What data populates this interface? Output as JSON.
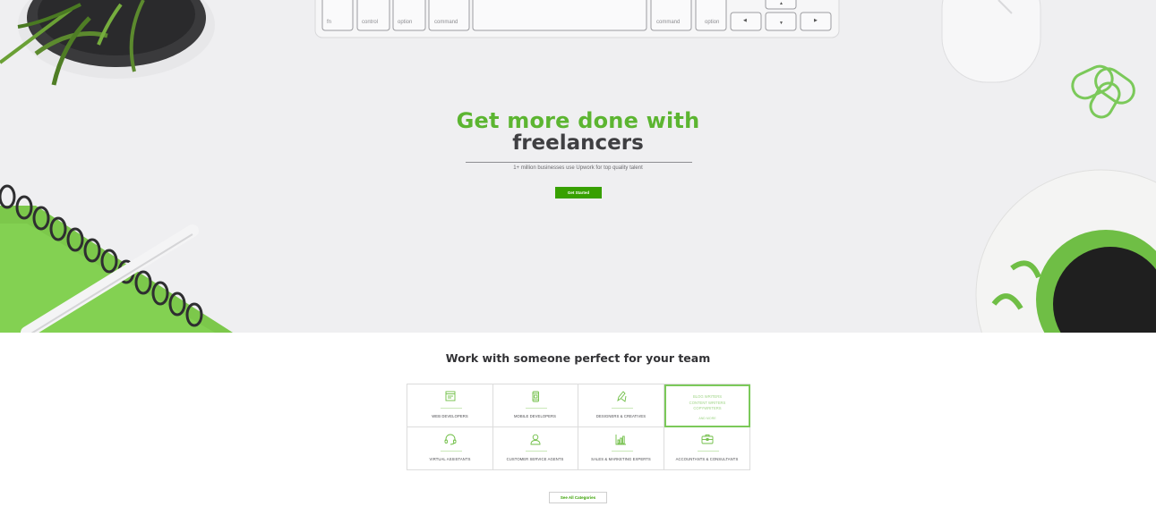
{
  "hero": {
    "title_line1": "Get more done with",
    "title_line2": "freelancers",
    "subtitle": "1+ million businesses use Upwork for top quality talent",
    "cta_label": "Get Started",
    "keyboard_keys": [
      "fn",
      "control",
      "option",
      "command",
      "command",
      "option"
    ],
    "arrow_keys": [
      "◀",
      "▲",
      "▼",
      "▶"
    ]
  },
  "section": {
    "title": "Work with someone perfect for your team",
    "categories": [
      {
        "label": "WEB DEVELOPERS",
        "icon": "browser-window-icon"
      },
      {
        "label": "MOBILE DEVELOPERS",
        "icon": "mobile-phone-icon"
      },
      {
        "label": "DESIGNERS & CREATIVES",
        "icon": "design-pencil-icon"
      },
      {
        "label": "",
        "icon": "",
        "highlight_items": [
          "BLOG WRITERS",
          "CONTENT WRITERS",
          "COPYWRITERS"
        ],
        "highlight_more": "AND MORE"
      },
      {
        "label": "VIRTUAL ASSISTANTS",
        "icon": "headset-icon"
      },
      {
        "label": "CUSTOMER SERVICE AGENTS",
        "icon": "user-icon"
      },
      {
        "label": "SALES & MARKETING EXPERTS",
        "icon": "bar-chart-icon"
      },
      {
        "label": "ACCOUNTANTS & CONSULTANTS",
        "icon": "briefcase-icon"
      }
    ],
    "see_all_label": "See All Categories"
  },
  "colors": {
    "brand_green": "#5cb531",
    "button_green": "#37a000",
    "dark_text": "#3f3f42",
    "highlight_border": "#7bc95a"
  }
}
